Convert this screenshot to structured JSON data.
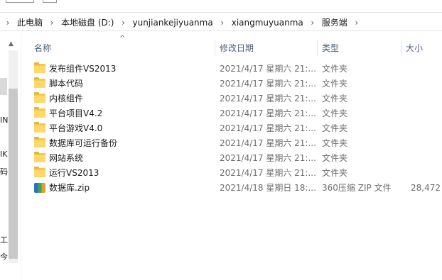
{
  "breadcrumb": [
    "此电脑",
    "本地磁盘 (D:)",
    "yunjiankejiyuanma",
    "xiangmuyuanma",
    "服务端"
  ],
  "nav": {
    "fragments": [
      "IN",
      "IK",
      "码",
      "工",
      "今"
    ]
  },
  "columns": {
    "name": "名称",
    "date": "修改日期",
    "type": "类型",
    "size": "大小"
  },
  "files": [
    {
      "name": "发布组件VS2013",
      "date": "2021/4/17 星期六 21:...",
      "type": "文件夹",
      "size": "",
      "icon": "folder-icon"
    },
    {
      "name": "脚本代码",
      "date": "2021/4/17 星期六 21:...",
      "type": "文件夹",
      "size": "",
      "icon": "folder-icon"
    },
    {
      "name": "内核组件",
      "date": "2021/4/17 星期六 21:...",
      "type": "文件夹",
      "size": "",
      "icon": "folder-icon"
    },
    {
      "name": "平台项目V4.2",
      "date": "2021/4/17 星期六 21:...",
      "type": "文件夹",
      "size": "",
      "icon": "folder-icon"
    },
    {
      "name": "平台游戏V4.0",
      "date": "2021/4/17 星期六 21:...",
      "type": "文件夹",
      "size": "",
      "icon": "folder-icon"
    },
    {
      "name": "数据库可运行备份",
      "date": "2021/4/17 星期六 21:...",
      "type": "文件夹",
      "size": "",
      "icon": "folder-icon"
    },
    {
      "name": "网站系统",
      "date": "2021/4/17 星期六 21:...",
      "type": "文件夹",
      "size": "",
      "icon": "folder-icon"
    },
    {
      "name": "运行VS2013",
      "date": "2021/4/17 星期六 21:...",
      "type": "文件夹",
      "size": "",
      "icon": "folder-icon"
    },
    {
      "name": "数据库.zip",
      "date": "2021/4/18 星期日 18:...",
      "type": "360压缩 ZIP 文件",
      "size": "28,472",
      "icon": "zip-archive-icon"
    }
  ]
}
